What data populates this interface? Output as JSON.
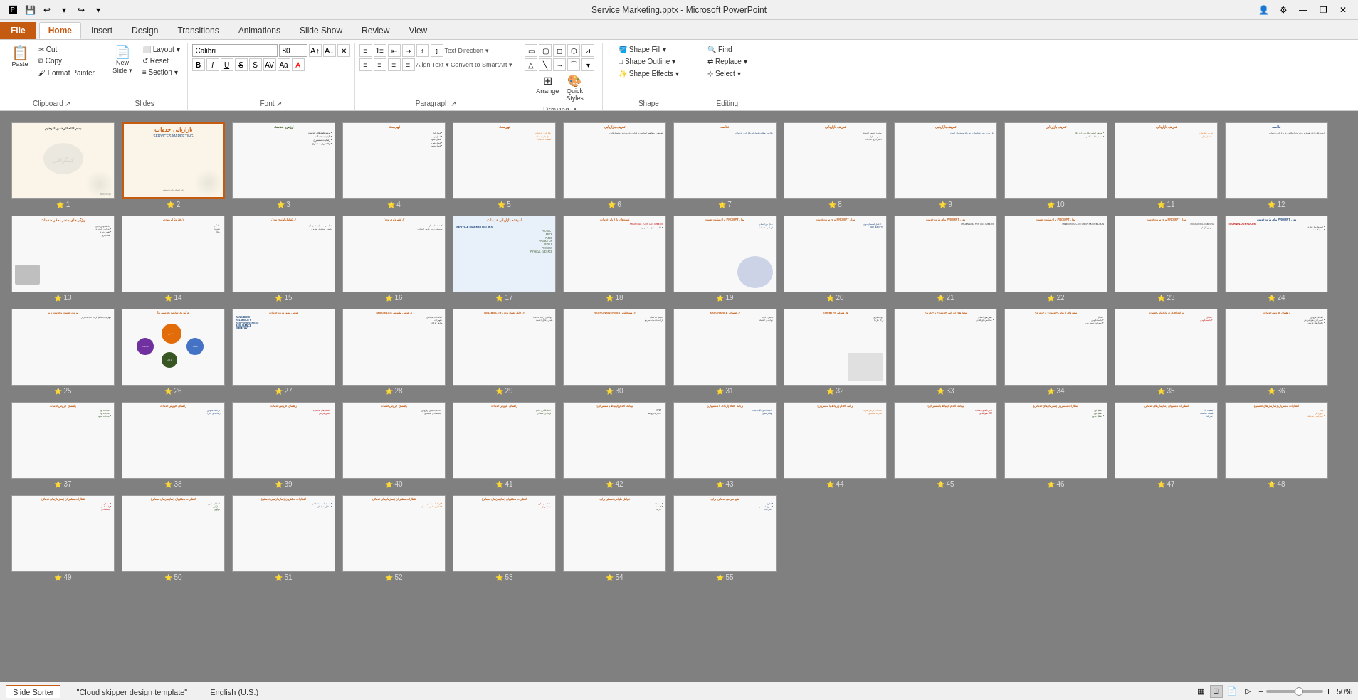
{
  "titleBar": {
    "title": "Service Marketing.pptx - Microsoft PowerPoint",
    "minimize": "—",
    "restore": "❐",
    "close": "✕"
  },
  "quickAccess": {
    "save": "💾",
    "undo": "↩",
    "redo": "↪",
    "customize": "▼"
  },
  "tabs": [
    {
      "label": "File",
      "id": "file",
      "active": false,
      "file": true
    },
    {
      "label": "Home",
      "id": "home",
      "active": true
    },
    {
      "label": "Insert",
      "id": "insert"
    },
    {
      "label": "Design",
      "id": "design"
    },
    {
      "label": "Transitions",
      "id": "transitions"
    },
    {
      "label": "Animations",
      "id": "animations"
    },
    {
      "label": "Slide Show",
      "id": "slideshow"
    },
    {
      "label": "Review",
      "id": "review"
    },
    {
      "label": "View",
      "id": "view"
    }
  ],
  "ribbon": {
    "groups": [
      {
        "id": "clipboard",
        "label": "Clipboard",
        "buttons": [
          {
            "id": "paste",
            "icon": "📋",
            "label": "Paste"
          },
          {
            "id": "cut",
            "label": "✂ Cut"
          },
          {
            "id": "copy",
            "label": "⧉ Copy"
          },
          {
            "id": "format-painter",
            "label": "🖌 Format Painter"
          }
        ]
      },
      {
        "id": "slides",
        "label": "Slides",
        "buttons": [
          {
            "id": "new-slide",
            "label": "New Slide"
          },
          {
            "id": "layout",
            "label": "Layout ▼"
          },
          {
            "id": "reset",
            "label": "Reset"
          },
          {
            "id": "section",
            "label": "Section ▼"
          }
        ]
      },
      {
        "id": "font",
        "label": "Font",
        "fontName": "Calibri",
        "fontSize": "80",
        "buttons": [
          "B",
          "I",
          "U",
          "S",
          "A",
          "Aa"
        ]
      },
      {
        "id": "paragraph",
        "label": "Paragraph",
        "buttons": [
          "≡",
          "≡",
          "≡",
          "↕",
          "↕",
          "↕",
          "↕"
        ]
      },
      {
        "id": "drawing",
        "label": "Drawing"
      },
      {
        "id": "shapeformat",
        "label": "Shape",
        "buttons": [
          {
            "id": "shape-fill",
            "label": "Shape Fill ▼"
          },
          {
            "id": "shape-outline",
            "label": "Shape Outline ▼"
          },
          {
            "id": "shape-effects",
            "label": "Shape Effects ▼"
          }
        ]
      },
      {
        "id": "editing",
        "label": "Editing",
        "buttons": [
          {
            "id": "find",
            "label": "Find"
          },
          {
            "id": "replace",
            "label": "Replace ▼"
          },
          {
            "id": "select",
            "label": "Select ▼"
          }
        ]
      }
    ]
  },
  "slides": [
    {
      "num": 1,
      "type": "title-arabic",
      "bg": "cream"
    },
    {
      "num": 2,
      "type": "title-main",
      "bg": "cream",
      "selected": true
    },
    {
      "num": 3,
      "type": "content-persian",
      "bg": "light"
    },
    {
      "num": 4,
      "type": "content-persian",
      "bg": "light"
    },
    {
      "num": 5,
      "type": "content-persian",
      "bg": "light"
    },
    {
      "num": 6,
      "type": "content-persian",
      "bg": "light"
    },
    {
      "num": 7,
      "type": "content-persian",
      "bg": "light"
    },
    {
      "num": 8,
      "type": "content-persian",
      "bg": "light"
    },
    {
      "num": 9,
      "type": "content-persian",
      "bg": "light"
    },
    {
      "num": 10,
      "type": "content-persian",
      "bg": "light"
    },
    {
      "num": 11,
      "type": "content-persian",
      "bg": "light"
    },
    {
      "num": 12,
      "type": "content-persian",
      "bg": "light"
    },
    {
      "num": 13,
      "type": "content-image",
      "bg": "light"
    },
    {
      "num": 14,
      "type": "content-persian",
      "bg": "light"
    },
    {
      "num": 15,
      "type": "content-persian",
      "bg": "light"
    },
    {
      "num": 16,
      "type": "content-persian",
      "bg": "light"
    },
    {
      "num": 17,
      "type": "content-persian",
      "bg": "blue"
    },
    {
      "num": 18,
      "type": "content-persian",
      "bg": "light"
    },
    {
      "num": 19,
      "type": "content-image2",
      "bg": "light"
    },
    {
      "num": 20,
      "type": "content-persian",
      "bg": "light"
    },
    {
      "num": 21,
      "type": "content-persian",
      "bg": "light"
    },
    {
      "num": 22,
      "type": "content-persian",
      "bg": "light"
    },
    {
      "num": 23,
      "type": "content-persian",
      "bg": "light"
    },
    {
      "num": 24,
      "type": "content-persian",
      "bg": "light"
    },
    {
      "num": 25,
      "type": "content-persian",
      "bg": "light"
    },
    {
      "num": 26,
      "type": "diagram-circles",
      "bg": "light"
    },
    {
      "num": 27,
      "type": "content-persian",
      "bg": "light"
    },
    {
      "num": 28,
      "type": "content-persian",
      "bg": "light"
    },
    {
      "num": 29,
      "type": "content-persian",
      "bg": "light"
    },
    {
      "num": 30,
      "type": "content-persian",
      "bg": "light"
    },
    {
      "num": 31,
      "type": "content-persian",
      "bg": "light"
    },
    {
      "num": 32,
      "type": "content-image3",
      "bg": "light"
    },
    {
      "num": 33,
      "type": "content-persian",
      "bg": "light"
    },
    {
      "num": 34,
      "type": "content-persian",
      "bg": "light"
    },
    {
      "num": 35,
      "type": "content-persian",
      "bg": "light"
    },
    {
      "num": 36,
      "type": "content-persian",
      "bg": "light"
    },
    {
      "num": 37,
      "type": "content-persian",
      "bg": "light"
    },
    {
      "num": 38,
      "type": "content-persian",
      "bg": "light"
    },
    {
      "num": 39,
      "type": "content-persian",
      "bg": "light"
    },
    {
      "num": 40,
      "type": "content-persian",
      "bg": "light"
    },
    {
      "num": 41,
      "type": "content-persian",
      "bg": "light"
    },
    {
      "num": 42,
      "type": "content-persian",
      "bg": "light"
    },
    {
      "num": 43,
      "type": "content-persian",
      "bg": "light"
    },
    {
      "num": 44,
      "type": "content-persian",
      "bg": "light"
    },
    {
      "num": 45,
      "type": "content-persian",
      "bg": "light"
    },
    {
      "num": 46,
      "type": "content-persian",
      "bg": "light"
    },
    {
      "num": 47,
      "type": "content-persian",
      "bg": "light"
    },
    {
      "num": 48,
      "type": "content-persian",
      "bg": "light"
    },
    {
      "num": 49,
      "type": "content-persian",
      "bg": "light"
    },
    {
      "num": 50,
      "type": "content-persian",
      "bg": "light"
    },
    {
      "num": 51,
      "type": "content-persian",
      "bg": "light"
    },
    {
      "num": 52,
      "type": "content-persian",
      "bg": "light"
    },
    {
      "num": 53,
      "type": "content-persian",
      "bg": "light"
    },
    {
      "num": 54,
      "type": "content-persian",
      "bg": "light"
    },
    {
      "num": 55,
      "type": "content-persian",
      "bg": "light"
    }
  ],
  "statusBar": {
    "tabs": [
      {
        "label": "Slide Sorter",
        "active": true
      },
      {
        "label": "\"Cloud skipper design template\"",
        "active": false
      },
      {
        "label": "English (U.S.)",
        "active": false
      }
    ],
    "zoom": "50%",
    "zoomValue": 50
  }
}
